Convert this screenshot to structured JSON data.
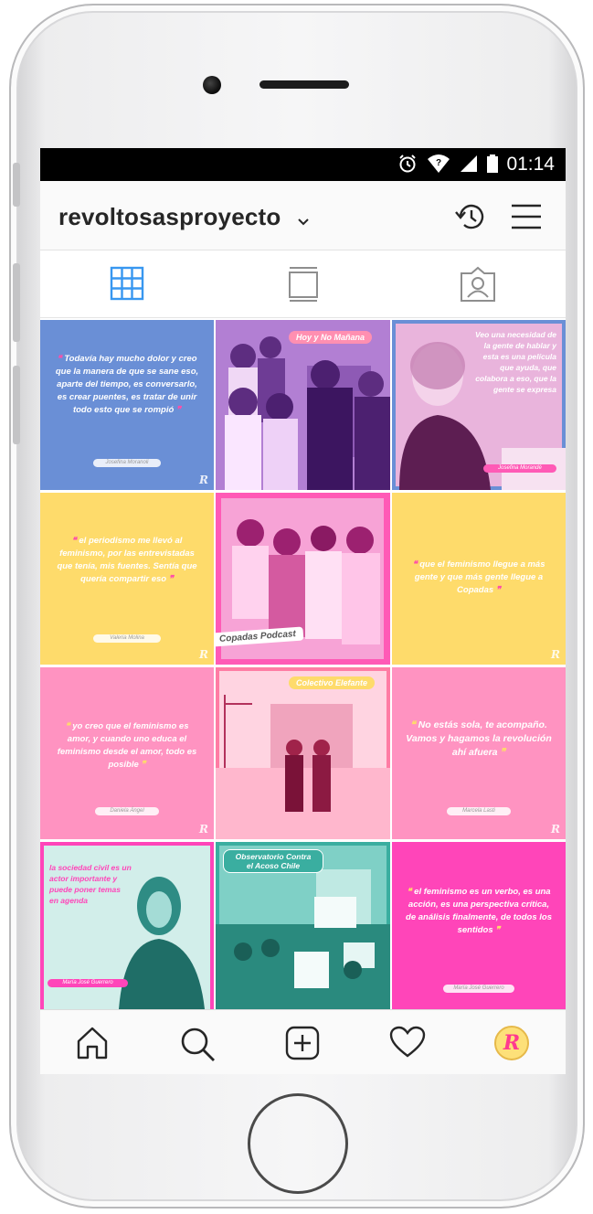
{
  "status_bar": {
    "time": "01:14",
    "icons": [
      "alarm-icon",
      "wifi-icon",
      "signal-icon",
      "battery-icon"
    ]
  },
  "profile": {
    "username": "revoltosasproyecto"
  },
  "tabs": [
    {
      "name": "grid",
      "icon": "grid-icon",
      "active": true,
      "active_color": "#3897f0"
    },
    {
      "name": "feed",
      "icon": "feed-icon",
      "active": false
    },
    {
      "name": "tagged",
      "icon": "tagged-icon",
      "active": false
    }
  ],
  "posts": [
    {
      "kind": "quote",
      "bg": "#6a8fd6",
      "text": "Todavía hay mucho dolor y creo que la manera de que se sane eso, aparte del tiempo, es conversarlo, es crear puentes, es tratar de unir todo esto que se rompió",
      "author": "Josefina Moranoli"
    },
    {
      "kind": "photo",
      "bg": "#b77bd8",
      "banner": "Hoy y No Mañana"
    },
    {
      "kind": "photo-quote",
      "bg": "#d86aa8",
      "text": "Veo una necesidad de la gente de hablar y esta es una película que ayuda, que colabora a eso, que la gente se expresa",
      "author": "Josefina Morandé"
    },
    {
      "kind": "quote",
      "bg": "#fedb6b",
      "text": "el periodismo me llevó al feminismo, por las entrevistadas que tenía, mis fuentes. Sentía que quería compartir eso",
      "author": "Valeria Molina"
    },
    {
      "kind": "photo",
      "bg": "#ff5ab6",
      "banner": "Copadas Podcast"
    },
    {
      "kind": "quote",
      "bg": "#fedb6b",
      "text": "que el feminismo llegue a más gente y que más gente llegue a Copadas",
      "author": ""
    },
    {
      "kind": "quote",
      "bg": "#ff93c1",
      "text": "yo creo que el feminismo es amor, y cuando uno educa el feminismo desde el amor, todo es posible",
      "author": "Daniela Ángel"
    },
    {
      "kind": "photo",
      "bg": "#ff7ca4",
      "banner": "Colectivo Elefante"
    },
    {
      "kind": "quote",
      "bg": "#ff93c1",
      "text": "No estás sola, te acompaño. Vamos y hagamos la revolución ahí afuera",
      "author": "Marcela Lasti"
    },
    {
      "kind": "photo-quote",
      "bg": "#50c7be",
      "text": "la sociedad civil es un actor importante y puede poner temas en agenda",
      "author": "María José Guerrero"
    },
    {
      "kind": "photo",
      "bg": "#3aaea0",
      "banner": "Observatorio Contra el Acoso Chile"
    },
    {
      "kind": "quote",
      "bg": "#ff45b9",
      "text": "el feminismo es un verbo, es una acción, es una perspectiva crítica, de análisis finalmente, de todos los sentidos",
      "author": "María José Guerrero"
    }
  ],
  "bottom_nav": [
    {
      "name": "home",
      "icon": "home-icon"
    },
    {
      "name": "search",
      "icon": "search-icon"
    },
    {
      "name": "new-post",
      "icon": "add-post-icon"
    },
    {
      "name": "activity",
      "icon": "heart-icon"
    },
    {
      "name": "profile",
      "icon": "profile-avatar",
      "letter": "R"
    }
  ],
  "post_logo": "R"
}
